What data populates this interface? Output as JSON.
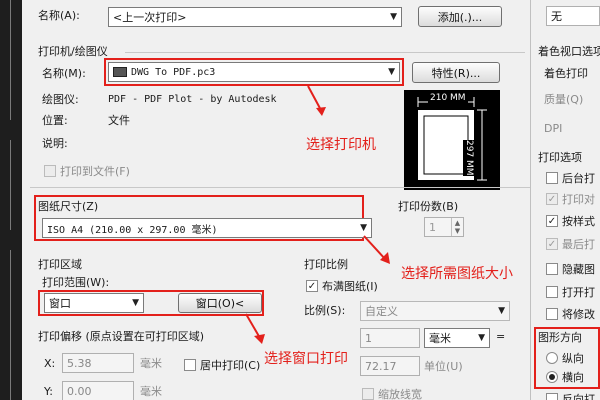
{
  "page_setup": {
    "name_label": "名称(A):",
    "name_value": "<上一次打印>",
    "add_button": "添加(.)..."
  },
  "printer": {
    "section_label": "打印机/绘图仪",
    "name_label": "名称(M):",
    "name_value": "DWG To PDF.pc3",
    "properties_button": "特性(R)...",
    "plotter_label": "绘图仪:",
    "plotter_value": "PDF - PDF Plot - by Autodesk",
    "location_label": "位置:",
    "location_value": "文件",
    "description_label": "说明:",
    "plot_to_file_label": "打印到文件(F)"
  },
  "preview": {
    "width_label": "210 MM",
    "height_label": "297 MM"
  },
  "paper_size": {
    "section_label": "图纸尺寸(Z)",
    "value": "ISO A4 (210.00 x 297.00 毫米)"
  },
  "copies": {
    "label": "打印份数(B)",
    "value": "1"
  },
  "plot_area": {
    "section_label": "打印区域",
    "range_label": "打印范围(W):",
    "range_value": "窗口",
    "window_button": "窗口(O)<"
  },
  "plot_scale": {
    "section_label": "打印比例",
    "fit_paper_label": "布满图纸(I)",
    "scale_label": "比例(S):",
    "scale_value": "自定义",
    "value1": "1",
    "unit_value": "毫米",
    "equals": "=",
    "value2": "72.17",
    "unit_label": "单位(U)",
    "lineweights_label": "缩放线宽"
  },
  "plot_offset": {
    "section_label": "打印偏移 (原点设置在可打印区域)",
    "x_label": "X:",
    "x_value": "5.38",
    "x_unit": "毫米",
    "center_label": "居中打印(C)",
    "y_label": "Y:",
    "y_value": "0.00",
    "y_unit": "毫米"
  },
  "right_panel": {
    "style_value": "无",
    "viewport_section": "着色视口选项",
    "shade_plot_label": "着色打印",
    "quality_label": "质量(Q)",
    "dpi_label": "DPI",
    "options_section": "打印选项",
    "options": [
      {
        "label": "后台打",
        "checked": false,
        "enabled": true
      },
      {
        "label": "打印对",
        "checked": true,
        "enabled": false
      },
      {
        "label": "按样式",
        "checked": true,
        "enabled": true
      },
      {
        "label": "最后打",
        "checked": true,
        "enabled": false
      },
      {
        "label": "隐藏图",
        "checked": false,
        "enabled": true
      },
      {
        "label": "打开打",
        "checked": false,
        "enabled": true
      },
      {
        "label": "将修改",
        "checked": false,
        "enabled": true
      }
    ],
    "orientation_section": "图形方向",
    "portrait_label": "纵向",
    "landscape_label": "横向",
    "reverse_label": "反向打"
  },
  "annotations": {
    "select_printer": "选择打印机",
    "select_paper": "选择所需图纸大小",
    "select_window": "选择窗口打印"
  }
}
